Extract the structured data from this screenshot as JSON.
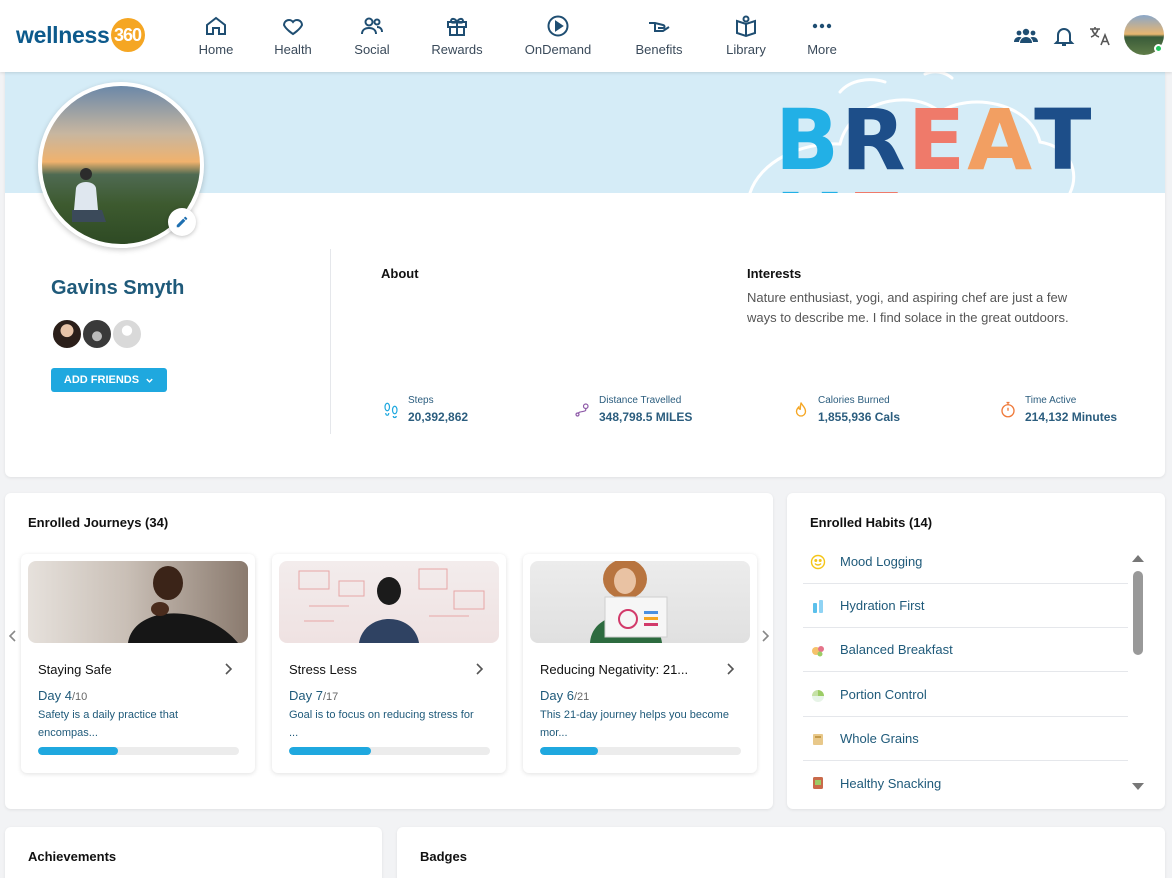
{
  "brand": {
    "logo_text": "wellness",
    "logo_badge": "360"
  },
  "nav": {
    "items": [
      {
        "label": "Home",
        "icon": "home-icon"
      },
      {
        "label": "Health",
        "icon": "heart-icon"
      },
      {
        "label": "Social",
        "icon": "people-icon"
      },
      {
        "label": "Rewards",
        "icon": "gift-icon"
      },
      {
        "label": "OnDemand",
        "icon": "play-icon"
      },
      {
        "label": "Benefits",
        "icon": "hand-icon"
      },
      {
        "label": "Library",
        "icon": "book-icon"
      },
      {
        "label": "More",
        "icon": "more-icon"
      }
    ]
  },
  "banner": {
    "word": "BREATHE",
    "colors": [
      "#22b0e6",
      "#1d4e89",
      "#ef7a6a",
      "#f29f62",
      "#1d4e89",
      "#22b0e6",
      "#ef7a6a"
    ]
  },
  "profile": {
    "name": "Gavins Smyth",
    "add_friends_label": "ADD FRIENDS",
    "about_heading": "About",
    "about_text": "",
    "interests_heading": "Interests",
    "interests_text": "Nature enthusiast, yogi, and aspiring chef are just a few ways to describe me. I find solace in the great outdoors."
  },
  "stats": [
    {
      "label": "Steps",
      "value": "20,392,862",
      "icon": "footsteps-icon",
      "color": "#1fa8df"
    },
    {
      "label": "Distance Travelled",
      "value": "348,798.5 MILES",
      "icon": "route-icon",
      "color": "#8e5aa8"
    },
    {
      "label": "Calories Burned",
      "value": "1,855,936 Cals",
      "icon": "flame-icon",
      "color": "#f5a623"
    },
    {
      "label": "Time Active",
      "value": "214,132 Minutes",
      "icon": "stopwatch-icon",
      "color": "#ef7a3a"
    }
  ],
  "journeys": {
    "title": "Enrolled Journeys (34)",
    "cards": [
      {
        "title": "Staying Safe",
        "day": "Day 4",
        "of": "/10",
        "desc": "Safety is a daily practice that encompas...",
        "progress": 0.4
      },
      {
        "title": "Stress Less",
        "day": "Day 7",
        "of": "/17",
        "desc": "Goal is to focus on reducing stress for ...",
        "progress": 0.41
      },
      {
        "title": "Reducing Negativity: 21...",
        "day": "Day 6",
        "of": "/21",
        "desc": "This 21-day journey helps you become mor...",
        "progress": 0.29
      }
    ]
  },
  "habits": {
    "title": "Enrolled Habits (14)",
    "items": [
      {
        "label": "Mood Logging",
        "icon": "smiley-icon"
      },
      {
        "label": "Hydration First",
        "icon": "water-bottle-icon"
      },
      {
        "label": "Balanced Breakfast",
        "icon": "breakfast-icon"
      },
      {
        "label": "Portion Control",
        "icon": "plate-icon"
      },
      {
        "label": "Whole Grains",
        "icon": "grain-icon"
      },
      {
        "label": "Healthy Snacking",
        "icon": "snack-icon"
      }
    ]
  },
  "achievements": {
    "title": "Achievements"
  },
  "badges": {
    "title": "Badges"
  }
}
